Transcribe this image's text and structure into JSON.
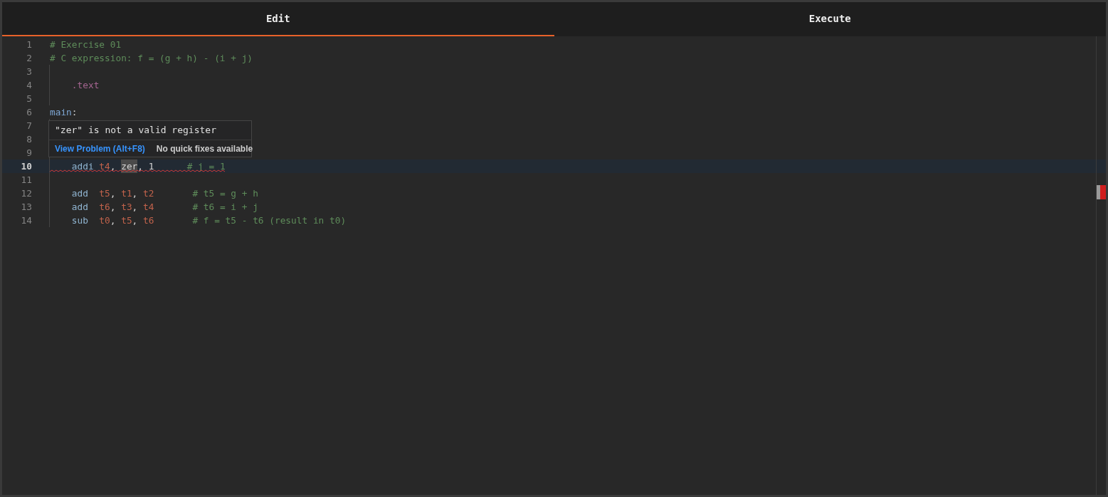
{
  "tabs": [
    {
      "label": "Edit",
      "selected": true
    },
    {
      "label": "Execute",
      "selected": false
    }
  ],
  "editor": {
    "lines": [
      {
        "number": "1",
        "current": false,
        "tokens": [
          {
            "kind": "comment",
            "text": "# Exercise 01"
          }
        ]
      },
      {
        "number": "2",
        "current": false,
        "tokens": [
          {
            "kind": "comment",
            "text": "# C expression: f = (g + h) - (i + j)"
          }
        ]
      },
      {
        "number": "3",
        "current": false
      },
      {
        "number": "4",
        "current": false,
        "tokens": [
          {
            "kind": "directive",
            "text": "    .text"
          }
        ]
      },
      {
        "number": "5",
        "current": false
      },
      {
        "number": "6",
        "current": false,
        "tokens": [
          {
            "kind": "label",
            "text": "main"
          },
          {
            "kind": "plain",
            "text": ":"
          }
        ]
      },
      {
        "number": "7",
        "current": false
      },
      {
        "number": "8",
        "current": false
      },
      {
        "number": "9",
        "current": false
      },
      {
        "number": "10",
        "current": true,
        "error": true,
        "tokens": [
          {
            "kind": "instr",
            "text": "    addi "
          },
          {
            "kind": "register",
            "text": "t4"
          },
          {
            "kind": "plain",
            "text": ", "
          },
          {
            "kind": "highlight",
            "text": "zer"
          },
          {
            "kind": "plain",
            "text": ", 1"
          },
          {
            "kind": "comment",
            "text": "      # j = 1"
          }
        ]
      },
      {
        "number": "11",
        "current": false
      },
      {
        "number": "12",
        "current": false,
        "tokens": [
          {
            "kind": "instr",
            "text": "    add  "
          },
          {
            "kind": "register",
            "text": "t5"
          },
          {
            "kind": "plain",
            "text": ", "
          },
          {
            "kind": "register",
            "text": "t1"
          },
          {
            "kind": "plain",
            "text": ", "
          },
          {
            "kind": "register",
            "text": "t2"
          },
          {
            "kind": "comment",
            "text": "       # t5 = g + h"
          }
        ]
      },
      {
        "number": "13",
        "current": false,
        "tokens": [
          {
            "kind": "instr",
            "text": "    add  "
          },
          {
            "kind": "register",
            "text": "t6"
          },
          {
            "kind": "plain",
            "text": ", "
          },
          {
            "kind": "register",
            "text": "t3"
          },
          {
            "kind": "plain",
            "text": ", "
          },
          {
            "kind": "register",
            "text": "t4"
          },
          {
            "kind": "comment",
            "text": "       # t6 = i + j"
          }
        ]
      },
      {
        "number": "14",
        "current": false,
        "tokens": [
          {
            "kind": "instr",
            "text": "    sub  "
          },
          {
            "kind": "register",
            "text": "t0"
          },
          {
            "kind": "plain",
            "text": ", "
          },
          {
            "kind": "register",
            "text": "t5"
          },
          {
            "kind": "plain",
            "text": ", "
          },
          {
            "kind": "register",
            "text": "t6"
          },
          {
            "kind": "comment",
            "text": "       # f = t5 - t6 (result in t0)"
          }
        ]
      }
    ]
  },
  "hover": {
    "message": "\"zer\" is not a valid register",
    "action": "View Problem (Alt+F8)",
    "note": "No quick fixes available"
  }
}
